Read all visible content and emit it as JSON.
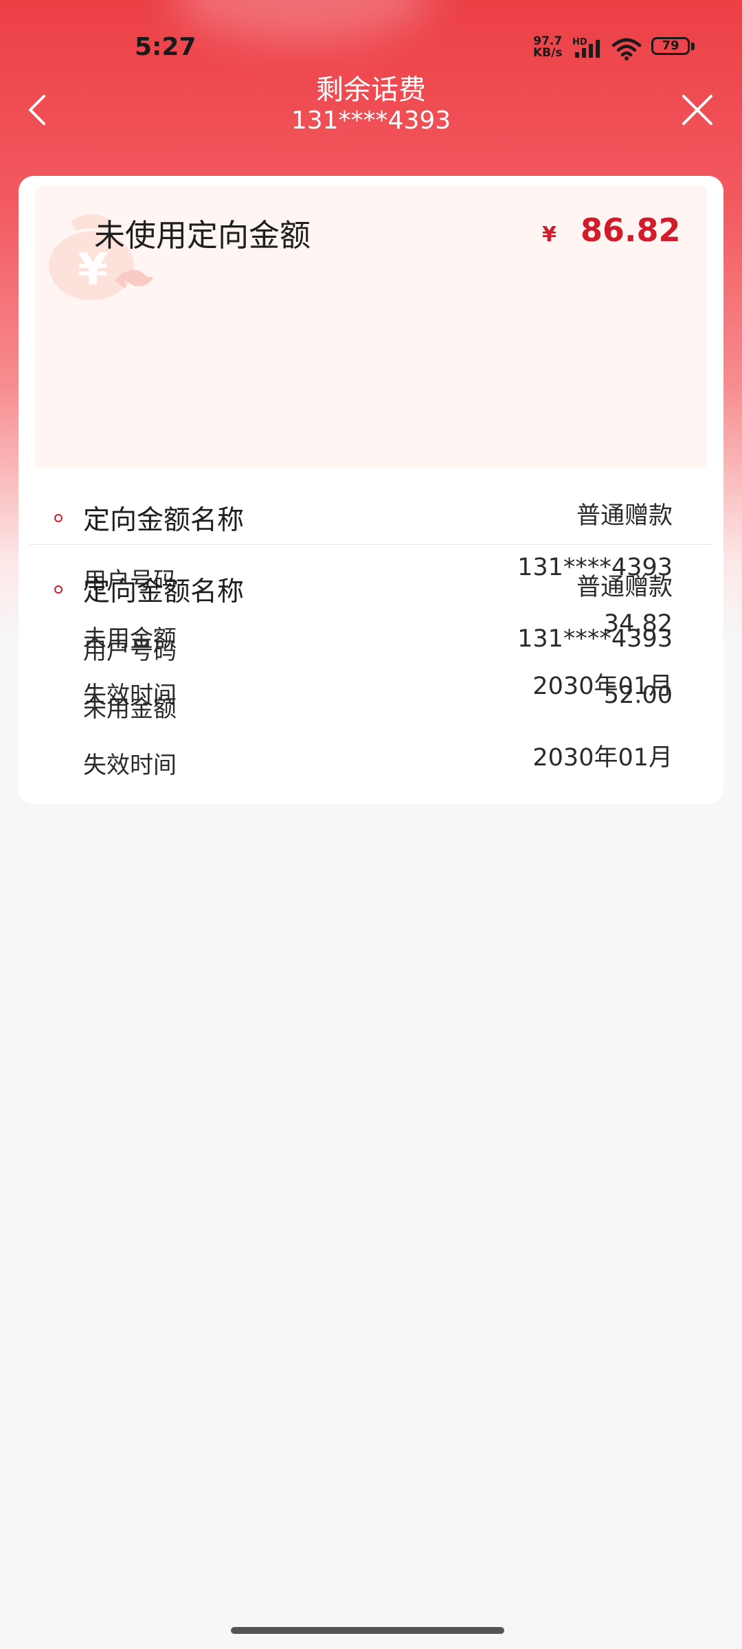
{
  "status_bar": {
    "time": "5:27",
    "net_speed_value": "97.7",
    "net_speed_unit": "KB/s",
    "hd_label": "HD",
    "battery": "79"
  },
  "header": {
    "title": "剩余话费",
    "subtitle": "131****4393"
  },
  "summary": {
    "label": "未使用定向金额",
    "currency": "¥",
    "amount": "86.82"
  },
  "records": [
    {
      "name_label": "定向金额名称",
      "name_value": "普通赠款",
      "phone_label": "用户号码",
      "phone_value": "131****4393",
      "unused_label": "未用金额",
      "unused_value": "34.82",
      "expiry_label": "失效时间",
      "expiry_value": "2030年01月"
    },
    {
      "name_label": "定向金额名称",
      "name_value": "普通赠款",
      "phone_label": "用户号码",
      "phone_value": "131****4393",
      "unused_label": "未用金额",
      "unused_value": "52.00",
      "expiry_label": "失效时间",
      "expiry_value": "2030年01月"
    }
  ],
  "colors": {
    "header_red": "#ec3f46",
    "amount_red": "#d01c2b"
  }
}
